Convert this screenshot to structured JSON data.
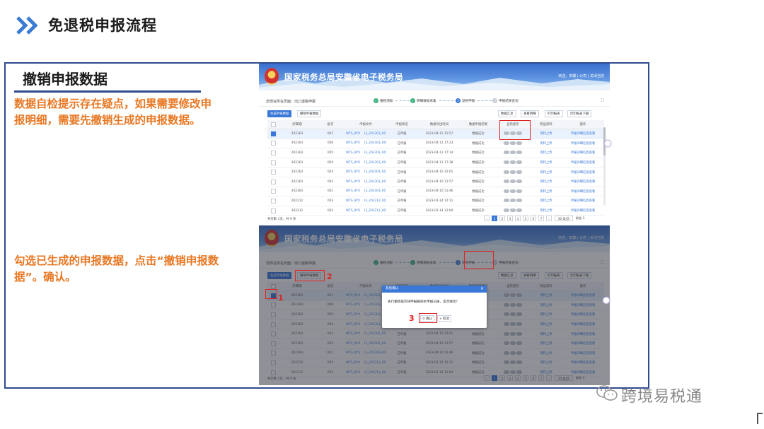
{
  "slide": {
    "title": "免退税申报流程",
    "section_title": "撤销申报数据",
    "note1": "数据自检提示存在疑点，如果需要修改申报明细，需要先撤销生成的申报数据。",
    "note2": "勾选已生成的申报数据，点击“撤销申报数据”。确认。",
    "watermark": "跨境易税通",
    "accent": "#e87722",
    "frame_color": "#2f4b8f"
  },
  "app": {
    "brand": "国家税务总局安徽省电子税务局",
    "toplinks": "欢迎，安徽 | 公司 | 关闭当前",
    "breadcrumb": "您现在所在页面：出口退税申报",
    "steps": [
      {
        "label": "报税须知",
        "state": "ok",
        "icon": "✓"
      },
      {
        "label": "明细数据采集",
        "state": "ok",
        "icon": "✓"
      },
      {
        "label": "退税申报",
        "state": "cur",
        "icon": "3"
      },
      {
        "label": "申报结果查询",
        "state": "todo",
        "icon": "4"
      }
    ],
    "buttons": {
      "generate": "生成申报数据",
      "revoke": "撤销申报数据",
      "summary": "数据汇总",
      "view_detail": "查看明细",
      "print": "打印报表",
      "export": "打印报表下载"
    },
    "columns": [
      "",
      "所属期",
      "批次",
      "申报文件",
      "申报状态",
      "数据导出时间",
      "数据申报结果",
      "自检提示",
      "附送资料",
      "操作"
    ],
    "rows": [
      {
        "period": "202303",
        "batch": "007",
        "file": "WTS_9YX",
        "code": "I3_202303_007",
        "status": "已申报",
        "time": "2023-04-12 15:57",
        "result": "数据成功",
        "attach": "资料上传",
        "op": "申报详细信息查看"
      },
      {
        "period": "202303",
        "batch": "006",
        "file": "WTS_9YX",
        "code": "I3_202303_006",
        "status": "已申报",
        "time": "2023-04-11 17:23",
        "result": "数据成功",
        "attach": "资料上传",
        "op": "申报详细信息查看"
      },
      {
        "period": "202303",
        "batch": "005",
        "file": "WTS_9YX",
        "code": "I3_202303_005",
        "status": "已申报",
        "time": "2023-04-11 17:14",
        "result": "数据成功",
        "attach": "资料上传",
        "op": "申报详细信息查看"
      },
      {
        "period": "202303",
        "batch": "004",
        "file": "WTS_9YX",
        "code": "I3_202303_004",
        "status": "已申报",
        "time": "2023-04-11 17:38",
        "result": "数据成功",
        "attach": "资料上传",
        "op": "申报详细信息查看"
      },
      {
        "period": "202303",
        "batch": "003",
        "file": "WTS_9YX",
        "code": "I3_202303_003",
        "status": "已申报",
        "time": "2023-04-10 12:01",
        "result": "数据成功",
        "attach": "资料上传",
        "op": "申报详细信息查看"
      },
      {
        "period": "202303",
        "batch": "002",
        "file": "WTS_9YX",
        "code": "I3_202303_002",
        "status": "已申报",
        "time": "2023-04-10 11:57",
        "result": "数据成功",
        "attach": "资料上传",
        "op": "申报详细信息查看"
      },
      {
        "period": "202303",
        "batch": "001",
        "file": "WTS_9YX",
        "code": "I3_202303_001",
        "status": "已申报",
        "time": "2023-04-10 11:46",
        "result": "数据成功",
        "attach": "资料上传",
        "op": "申报详细信息查看"
      },
      {
        "period": "202212",
        "batch": "003",
        "file": "WTS_9YX",
        "code": "I3_202212_003",
        "status": "已申报",
        "time": "2023-01-14 12:11",
        "result": "数据成功",
        "attach": "资料上传",
        "op": "申报详细信息查看"
      },
      {
        "period": "202212",
        "batch": "002",
        "file": "WTS_9YX",
        "code": "I3_202212_002",
        "status": "已申报",
        "time": "2023-01-14 12:04",
        "result": "数据成功",
        "attach": "资料上传",
        "op": "申报详细信息查看"
      }
    ],
    "total": "共計數 1页，共 9 条",
    "pages": [
      "‹",
      "1",
      "2",
      "3",
      "4",
      "5",
      "6",
      "7",
      "›"
    ],
    "page_size": "10 条/页",
    "jump": "前往",
    "jump_page": "1",
    "dialog": {
      "title": "系统确认",
      "message": "执行撤销操作将申报删除本申报记录，是否继续？",
      "ok": "确认",
      "cancel": "取消"
    },
    "marks": [
      "1",
      "2",
      "3"
    ]
  }
}
